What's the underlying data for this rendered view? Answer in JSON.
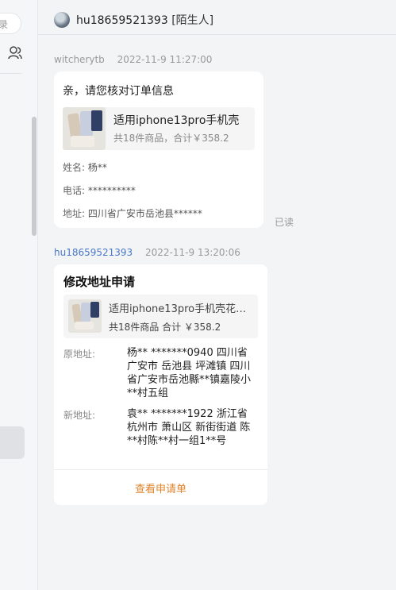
{
  "sidebar": {
    "search_partial": "录"
  },
  "header": {
    "username": "hu18659521393",
    "tag": "[陌生人]"
  },
  "messages": [
    {
      "sender": "witcherytb",
      "time": "2022-11-9 11:27:00",
      "greeting": "亲，请您核对订单信息",
      "product": {
        "name": "适用iphone13pro手机壳",
        "summary": "共18件商品，合计￥358.2"
      },
      "fields": [
        {
          "label": "姓名:",
          "value": "杨**"
        },
        {
          "label": "电话:",
          "value": "**********"
        },
        {
          "label": "地址:",
          "value": "四川省广安市岳池县******"
        }
      ],
      "status": "已读"
    },
    {
      "sender": "hu18659521393",
      "time": "2022-11-9 13:20:06",
      "title": "修改地址申请",
      "product": {
        "name": "适用iphone13pro手机壳花…",
        "summary": "共18件商品  合计 ￥358.2"
      },
      "old_label": "原地址:",
      "old_address": "杨** *******0940 四川省 广安市 岳池县 坪滩镇 四川省广安市岳池縣**镇嘉陵小**村五组",
      "new_label": "新地址:",
      "new_address": "袁** *******1922 浙江省 杭州市 萧山区 新街街道 陈**村陈**村一组1**号",
      "action": "查看申请单"
    }
  ],
  "colors": {
    "accent_link": "#4a78c9",
    "action_orange": "#e0832b"
  }
}
